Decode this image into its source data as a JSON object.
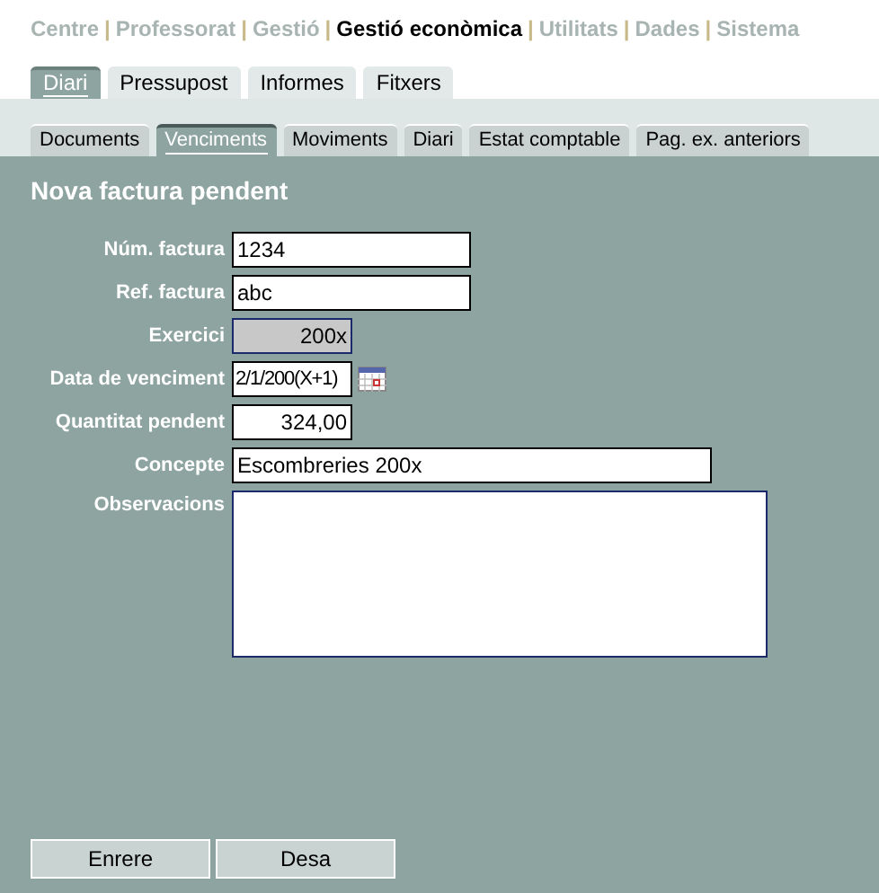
{
  "top_menu": {
    "separator": "|",
    "items": [
      {
        "label": "Centre",
        "selected": false
      },
      {
        "label": "Professorat",
        "selected": false
      },
      {
        "label": "Gestió",
        "selected": false
      },
      {
        "label": "Gestió econòmica",
        "selected": true
      },
      {
        "label": "Utilitats",
        "selected": false
      },
      {
        "label": "Dades",
        "selected": false
      },
      {
        "label": "Sistema",
        "selected": false
      }
    ]
  },
  "tabs": [
    {
      "label": "Diari",
      "selected": true
    },
    {
      "label": "Pressupost",
      "selected": false
    },
    {
      "label": "Informes",
      "selected": false
    },
    {
      "label": "Fitxers",
      "selected": false
    }
  ],
  "subtabs": [
    {
      "label": "Documents",
      "selected": false
    },
    {
      "label": "Venciments",
      "selected": true
    },
    {
      "label": "Moviments",
      "selected": false
    },
    {
      "label": "Diari",
      "selected": false
    },
    {
      "label": "Estat comptable",
      "selected": false
    },
    {
      "label": "Pag. ex. anteriors",
      "selected": false
    }
  ],
  "form": {
    "title": "Nova factura pendent",
    "fields": [
      {
        "label": "Núm. factura",
        "kind": "text",
        "value": "1234"
      },
      {
        "label": "Ref. factura",
        "kind": "text",
        "value": "abc"
      },
      {
        "label": "Exercici",
        "kind": "readonly",
        "value": "200x"
      },
      {
        "label": "Data de venciment",
        "kind": "date",
        "value": "2/1/200(X+1)"
      },
      {
        "label": "Quantitat pendent",
        "kind": "amount",
        "value": "324,00"
      },
      {
        "label": "Concepte",
        "kind": "wide-text",
        "value": "Escombreries 200x"
      },
      {
        "label": "Observacions",
        "kind": "textarea"
      }
    ]
  },
  "buttons": [
    "Enrere",
    "Desa"
  ]
}
